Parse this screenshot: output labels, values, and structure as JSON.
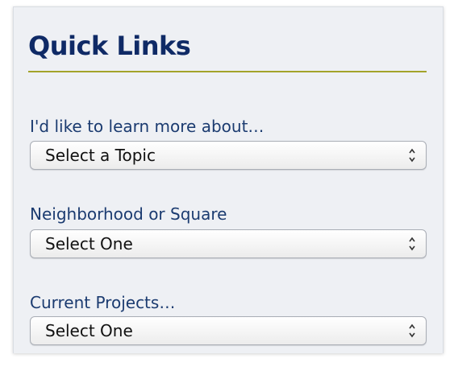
{
  "quick_links": {
    "title": "Quick Links",
    "fields": [
      {
        "label": "I'd like to learn more about…",
        "selected": "Select a Topic"
      },
      {
        "label": "Neighborhood or Square",
        "selected": "Select One"
      },
      {
        "label": "Current Projects…",
        "selected": "Select One"
      }
    ]
  },
  "colors": {
    "title": "#0f2a66",
    "rule": "#a3a32a",
    "label": "#1b3b70",
    "panel_bg": "#eef0f4"
  },
  "icons": {
    "select_arrows": "up-down-chevrons-icon"
  }
}
